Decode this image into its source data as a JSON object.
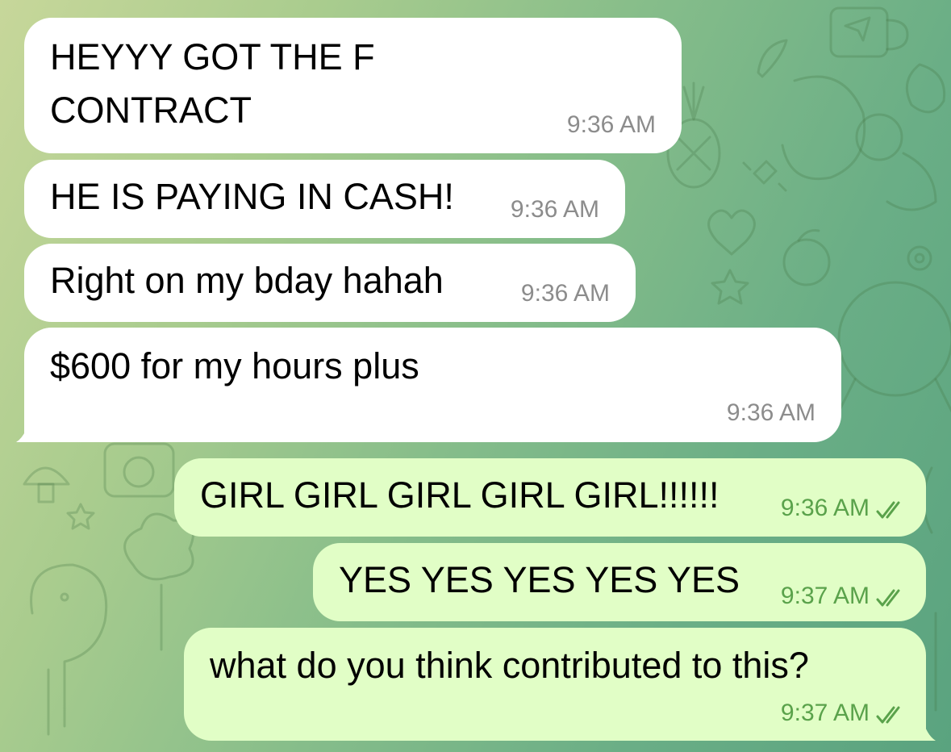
{
  "colors": {
    "incoming_bubble": "#ffffff",
    "outgoing_bubble": "#e1fec6",
    "incoming_time": "#8c8c8c",
    "outgoing_time_and_checks": "#5aa24b"
  },
  "messages": [
    {
      "direction": "incoming",
      "lines": [
        "HEYYY GOT THE F",
        "CONTRACT"
      ],
      "time": "9:36 AM",
      "redacted": true
    },
    {
      "direction": "incoming",
      "lines": [
        "HE IS PAYING IN CASH!"
      ],
      "time": "9:36 AM"
    },
    {
      "direction": "incoming",
      "lines": [
        "Right on my bday hahah"
      ],
      "time": "9:36 AM"
    },
    {
      "direction": "incoming",
      "lines": [
        "$600 for my hours plus"
      ],
      "time": "9:36 AM",
      "redacted": true
    },
    {
      "direction": "outgoing",
      "lines": [
        "GIRL GIRL GIRL GIRL GIRL!!!!!!"
      ],
      "time": "9:36 AM",
      "status_icon": "double-check-icon"
    },
    {
      "direction": "outgoing",
      "lines": [
        "YES YES YES YES YES"
      ],
      "time": "9:37 AM",
      "status_icon": "double-check-icon"
    },
    {
      "direction": "outgoing",
      "lines": [
        "what do you think contributed to this?"
      ],
      "time": "9:37 AM",
      "status_icon": "double-check-icon"
    }
  ]
}
